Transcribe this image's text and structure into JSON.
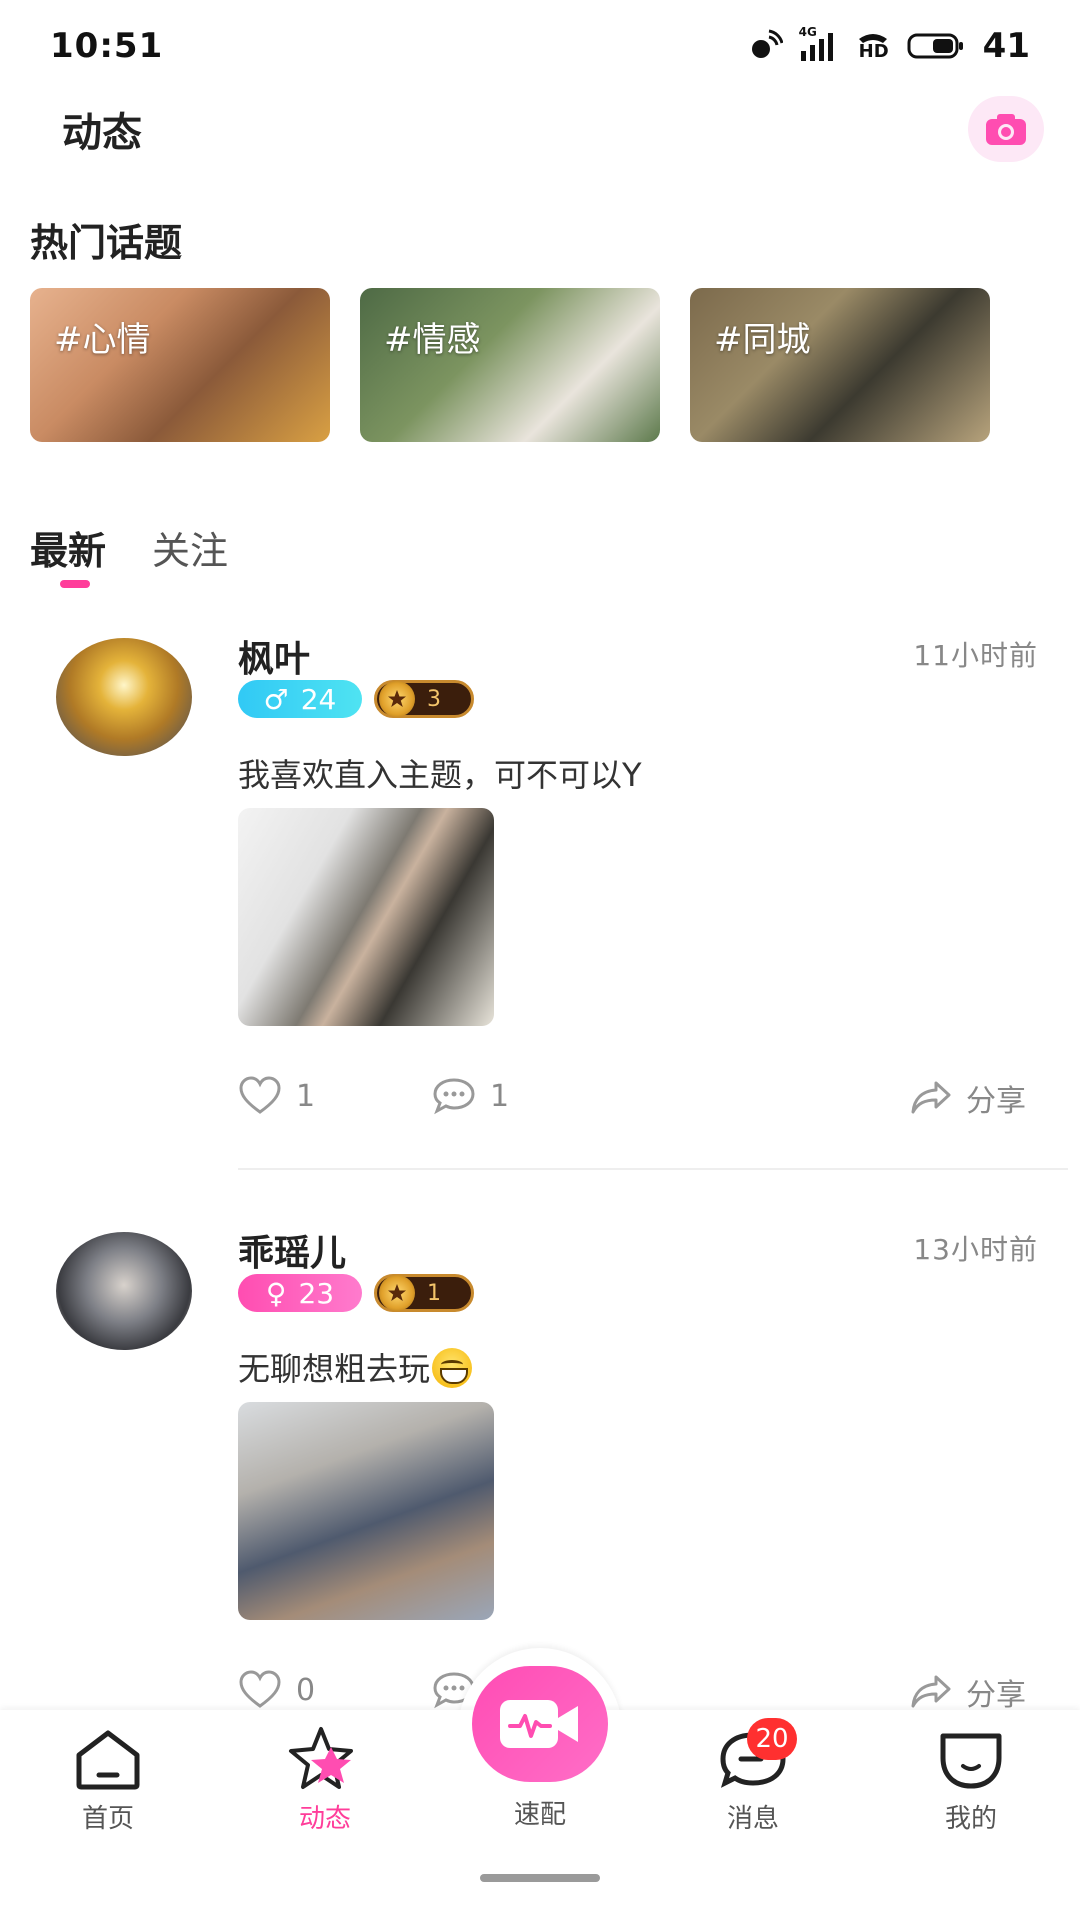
{
  "status_bar": {
    "time": "10:51",
    "battery": "41",
    "network": "4G",
    "hd": "HD"
  },
  "header": {
    "title": "动态"
  },
  "hot_topics": {
    "title": "热门话题",
    "items": [
      {
        "label": "#心情"
      },
      {
        "label": "#情感"
      },
      {
        "label": "#同城"
      }
    ]
  },
  "tabs": [
    {
      "label": "最新",
      "active": true
    },
    {
      "label": "关注",
      "active": false
    }
  ],
  "posts": [
    {
      "username": "枫叶",
      "time": "11小时前",
      "gender": "male",
      "gender_symbol": "♂",
      "age": "24",
      "level": "3",
      "text": "我喜欢直入主题，可不可以Y",
      "likes": "1",
      "comments": "1",
      "share": "分享"
    },
    {
      "username": "乖瑶儿",
      "time": "13小时前",
      "gender": "female",
      "gender_symbol": "♀",
      "age": "23",
      "level": "1",
      "text": "无聊想粗去玩",
      "likes": "0",
      "comments": "",
      "share": "分享"
    }
  ],
  "bottom_nav": {
    "items": [
      {
        "label": "首页",
        "icon": "home-icon"
      },
      {
        "label": "动态",
        "icon": "star-icon",
        "active": true
      },
      {
        "label": "速配",
        "icon": "video-icon"
      },
      {
        "label": "消息",
        "icon": "message-icon",
        "badge": "20"
      },
      {
        "label": "我的",
        "icon": "profile-icon"
      }
    ]
  },
  "colors": {
    "accent": "#ff3d9a",
    "male": "#31c9f5",
    "female": "#ff4db1"
  }
}
